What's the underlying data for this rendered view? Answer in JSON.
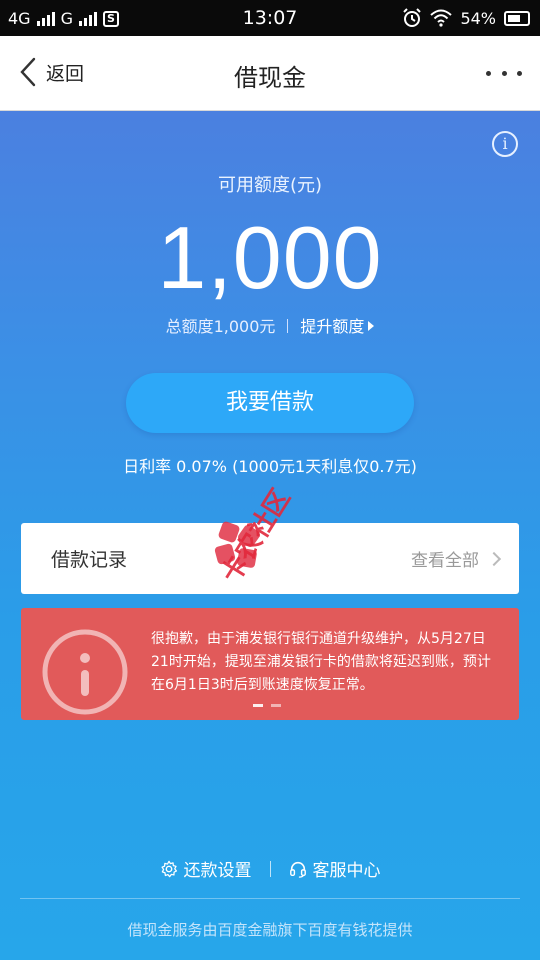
{
  "status_bar": {
    "network1": "4G",
    "network2": "G",
    "time": "13:07",
    "battery": "54%"
  },
  "nav": {
    "back_label": "返回",
    "title": "借现金"
  },
  "hero": {
    "limit_label": "可用额度(元)",
    "limit_amount": "1,000",
    "total_limit": "总额度1,000元",
    "raise_limit": "提升额度",
    "borrow_button": "我要借款",
    "rate_text": "日利率 0.07% (1000元1天利息仅0.7元)"
  },
  "records": {
    "title": "借款记录",
    "view_all": "查看全部"
  },
  "notice": {
    "text": "很抱歉，由于浦发银行银行通道升级维护，从5月27日21时开始，提现至浦发银行卡的借款将延迟到账，预计在6月1日3时后到账速度恢复正常。"
  },
  "bottom": {
    "repay_settings": "还款设置",
    "service_center": "客服中心",
    "footer": "借现金服务由百度金融旗下百度有钱花提供"
  },
  "watermark": {
    "text": "卡农社区"
  },
  "colors": {
    "hero_top": "#4b80e0",
    "hero_bottom": "#27a6ea",
    "button": "#2da8f8",
    "notice": "#e15a5a"
  }
}
